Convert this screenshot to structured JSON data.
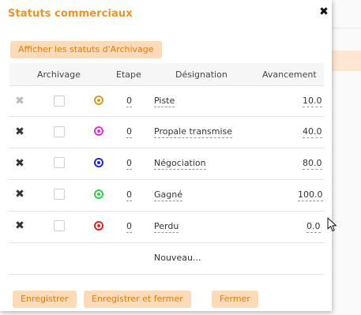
{
  "dialog": {
    "title": "Statuts commerciaux",
    "close_label": "✖",
    "archive_button": "Afficher les statuts d'Archivage",
    "columns": {
      "archivage": "Archivage",
      "etape": "Etape",
      "designation": "Désignation",
      "avancement": "Avancement"
    },
    "rows": [
      {
        "delete": "✖",
        "etape": "0",
        "designation": "Piste",
        "avancement": "10.0",
        "color": "#d69a1e",
        "archived": false
      },
      {
        "delete": "✖",
        "etape": "0",
        "designation": "Propale transmise",
        "avancement": "40.0",
        "color": "#e32ee3",
        "archived": false
      },
      {
        "delete": "✖",
        "etape": "0",
        "designation": "Négociation",
        "avancement": "80.0",
        "color": "#2727c9",
        "archived": false
      },
      {
        "delete": "✖",
        "etape": "0",
        "designation": "Gagné",
        "avancement": "100.0",
        "color": "#2fd14a",
        "archived": false
      },
      {
        "delete": "✖",
        "etape": "0",
        "designation": "Perdu",
        "avancement": "0.0",
        "color": "#e02424",
        "archived": false
      }
    ],
    "new_row": "Nouveau...",
    "buttons": {
      "save": "Enregistrer",
      "save_close": "Enregistrer et fermer",
      "close": "Fermer"
    }
  }
}
